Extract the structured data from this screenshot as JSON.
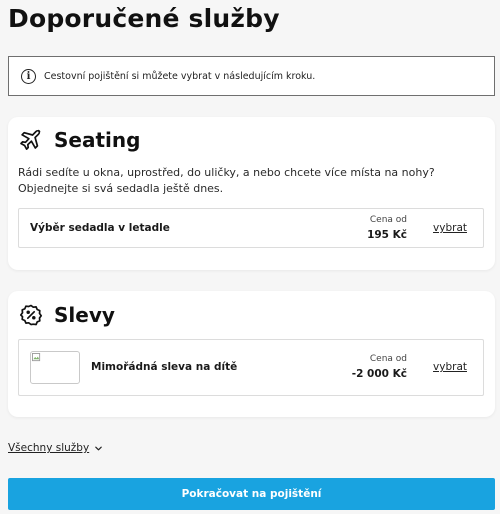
{
  "page_title": "Doporučené služby",
  "info": {
    "icon": "info-icon",
    "text": "Cestovní pojištění si můžete vybrat v následujícím kroku."
  },
  "seating": {
    "icon": "airplane-icon",
    "title": "Seating",
    "description": "Rádi sedíte u okna, uprostřed, do uličky, a nebo chcete více místa na nohy? Objednejte si svá sedadla ještě dnes.",
    "item": {
      "name": "Výběr sedadla v letadle",
      "price_label": "Cena od",
      "price_value": "195 Kč",
      "action": "vybrat"
    }
  },
  "discounts": {
    "icon": "discount-badge-icon",
    "title": "Slevy",
    "item": {
      "image": "broken-image-icon",
      "name": "Mimořádná sleva na dítě",
      "price_label": "Cena od",
      "price_value": "-2 000 Kč",
      "action": "vybrat"
    }
  },
  "all_services": {
    "label": "Všechny služby",
    "icon": "chevron-down-icon"
  },
  "continue_button": "Pokračovat na pojištění",
  "colors": {
    "primary_button": "#19a3e0",
    "background": "#f6f6f6"
  }
}
